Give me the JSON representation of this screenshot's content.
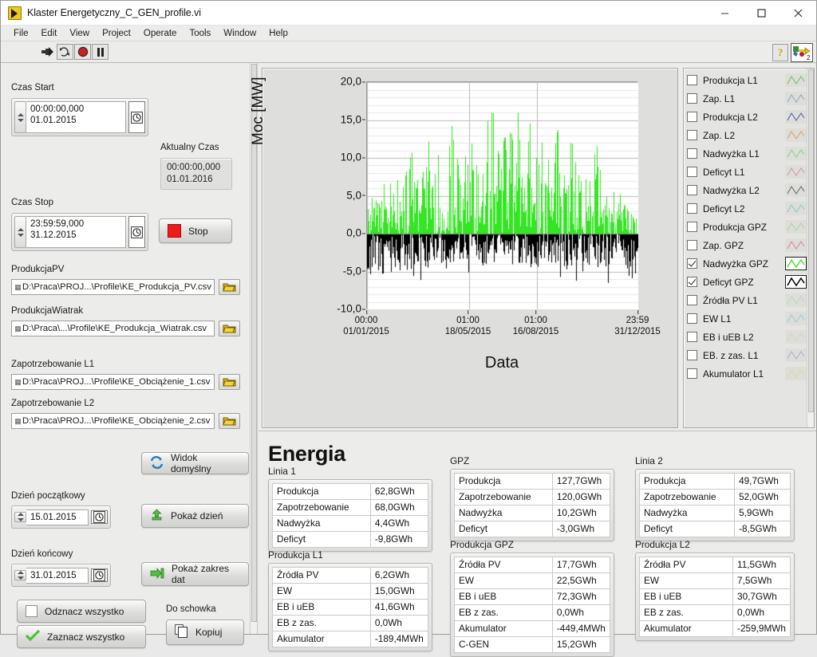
{
  "window": {
    "title": "Klaster Energetyczny_C_GEN_profile.vi",
    "minimize": "–",
    "maximize": "□",
    "close": "✕"
  },
  "menu": [
    "File",
    "Edit",
    "View",
    "Project",
    "Operate",
    "Tools",
    "Window",
    "Help"
  ],
  "toolbar": {
    "run": "run-arrow",
    "run_continuous": "run-continuous",
    "abort": "abort-execution",
    "pause": "pause",
    "help": "?",
    "vi_badge": "2"
  },
  "left_panel": {
    "czas_start": {
      "label": "Czas Start",
      "time": "00:00:00,000",
      "date": "01.01.2015"
    },
    "aktualny_czas": {
      "label": "Aktualny Czas",
      "time": "00:00:00,000",
      "date": "01.01.2016"
    },
    "czas_stop": {
      "label": "Czas Stop",
      "time": "23:59:59,000",
      "date": "31.12.2015"
    },
    "stop_button": "Stop",
    "paths": [
      {
        "label": "ProdukcjaPV",
        "value": "D:\\Praca\\PROJ...\\Profile\\KE_Produkcja_PV.csv"
      },
      {
        "label": "ProdukcjaWiatrak",
        "value": "D:\\Praca\\...\\Profile\\KE_Produkcja_Wiatrak.csv"
      },
      {
        "label": "Zapotrzebowanie L1",
        "value": "D:\\Praca\\PROJ...\\Profile\\KE_Obciążenie_1.csv"
      },
      {
        "label": "Zapotrzebowanie L2",
        "value": "D:\\Praca\\PROJ...\\Profile\\KE_Obciążenie_2.csv"
      }
    ],
    "widok_domyslny": "Widok domyślny",
    "dzien_poczatkowy": {
      "label": "Dzień początkowy",
      "value": "15.01.2015"
    },
    "pokaz_dzien": "Pokaż dzień",
    "dzien_koncowy": {
      "label": "Dzień końcowy",
      "value": "31.01.2015"
    },
    "pokaz_zakres": "Pokaż zakres dat",
    "odznacz_wszystko": "Odznacz wszystko",
    "zaznacz_wszystko": "Zaznacz wszystko",
    "do_schowka_label": "Do schowka",
    "kopiuj": "Kopiuj"
  },
  "chart_data": {
    "type": "area",
    "title": "",
    "xlabel": "Data",
    "ylabel": "Moc [MW]",
    "ylim": [
      -10.0,
      20.0
    ],
    "yticks": [
      "20,0",
      "15,0",
      "10,0",
      "5,0",
      "0,0",
      "-5,0",
      "-10,0"
    ],
    "ytick_values": [
      20.0,
      15.0,
      10.0,
      5.0,
      0.0,
      -5.0,
      -10.0
    ],
    "grid": true,
    "xticks": [
      {
        "time": "00:00",
        "date": "01/01/2015"
      },
      {
        "time": "01:00",
        "date": "18/05/2015"
      },
      {
        "time": "01:00",
        "date": "16/08/2015"
      },
      {
        "time": "23:59",
        "date": "31/12/2015"
      }
    ],
    "series": [
      {
        "name": "Nadwyżka GPZ",
        "color": "#33e622",
        "description": "surplus power, positive spikes up to ~16 MW",
        "range": [
          0.0,
          16.0
        ]
      },
      {
        "name": "Deficyt GPZ",
        "color": "#000000",
        "description": "deficit power, negative spikes down to ~-6.5 MW",
        "range": [
          -6.5,
          0.0
        ]
      }
    ]
  },
  "legend": {
    "items": [
      {
        "label": "Produkcja L1",
        "checked": false,
        "color": "#79bf6e"
      },
      {
        "label": "Zap. L1",
        "checked": false,
        "color": "#9aa8c0"
      },
      {
        "label": "Produkcja L2",
        "checked": false,
        "color": "#5566a8"
      },
      {
        "label": "Zap. L2",
        "checked": false,
        "color": "#e0a06a"
      },
      {
        "label": "Nadwyżka L1",
        "checked": false,
        "color": "#8fd08a"
      },
      {
        "label": "Deficyt L1",
        "checked": false,
        "color": "#d49aa8"
      },
      {
        "label": "Nadwyżka L2",
        "checked": false,
        "color": "#6f6f6f"
      },
      {
        "label": "Deficyt L2",
        "checked": false,
        "color": "#8fc9c6"
      },
      {
        "label": "Produkcja GPZ",
        "checked": false,
        "color": "#a8d8a8"
      },
      {
        "label": "Zap. GPZ",
        "checked": false,
        "color": "#d08f9a"
      },
      {
        "label": "Nadwyżka GPZ",
        "checked": true,
        "color": "#4ce52f"
      },
      {
        "label": "Deficyt GPZ",
        "checked": true,
        "color": "#000000"
      },
      {
        "label": "Źródła PV L1",
        "checked": false,
        "color": "#bcd8bc"
      },
      {
        "label": "EW L1",
        "checked": false,
        "color": "#9fc8e0"
      },
      {
        "label": "EB i uEB L2",
        "checked": false,
        "color": "#cfd9b8"
      },
      {
        "label": "EB. z zas. L1",
        "checked": false,
        "color": "#b9a8d4"
      },
      {
        "label": "Akumulator L1",
        "checked": false,
        "color": "#ded8a8"
      }
    ]
  },
  "energia": {
    "heading": "Energia",
    "tables": [
      {
        "caption": "Linia 1",
        "rows": [
          [
            "Produkcja",
            "62,8GWh"
          ],
          [
            "Zapotrzebowanie",
            "68,0GWh"
          ],
          [
            "Nadwyżka",
            "4,4GWh"
          ],
          [
            "Deficyt",
            "-9,8GWh"
          ]
        ]
      },
      {
        "caption": "Produkcja L1",
        "rows": [
          [
            "Źródła PV",
            "6,2GWh"
          ],
          [
            "EW",
            "15,0GWh"
          ],
          [
            "EB i uEB",
            "41,6GWh"
          ],
          [
            "EB z zas.",
            "0,0Wh"
          ],
          [
            "Akumulator",
            "-189,4MWh"
          ]
        ]
      },
      {
        "caption": "GPZ",
        "rows": [
          [
            "Produkcja",
            "127,7GWh"
          ],
          [
            "Zapotrzebowanie",
            "120,0GWh"
          ],
          [
            "Nadwyżka",
            "10,2GWh"
          ],
          [
            "Deficyt",
            "-3,0GWh"
          ]
        ]
      },
      {
        "caption": "Produkcja GPZ",
        "rows": [
          [
            "Źródła PV",
            "17,7GWh"
          ],
          [
            "EW",
            "22,5GWh"
          ],
          [
            "EB i uEB",
            "72,3GWh"
          ],
          [
            "EB z zas.",
            "0,0Wh"
          ],
          [
            "Akumulator",
            "-449,4MWh"
          ],
          [
            "C-GEN",
            "15,2GWh"
          ]
        ]
      },
      {
        "caption": "Linia 2",
        "rows": [
          [
            "Produkcja",
            "49,7GWh"
          ],
          [
            "Zapotrzebowanie",
            "52,0GWh"
          ],
          [
            "Nadwyżka",
            "5,9GWh"
          ],
          [
            "Deficyt",
            "-8,5GWh"
          ]
        ]
      },
      {
        "caption": "Produkcja L2",
        "rows": [
          [
            "Źródła PV",
            "11,5GWh"
          ],
          [
            "EW",
            "7,5GWh"
          ],
          [
            "EB i uEB",
            "30,7GWh"
          ],
          [
            "EB z zas.",
            "0,0Wh"
          ],
          [
            "Akumulator",
            "-259,9MWh"
          ]
        ]
      }
    ]
  }
}
